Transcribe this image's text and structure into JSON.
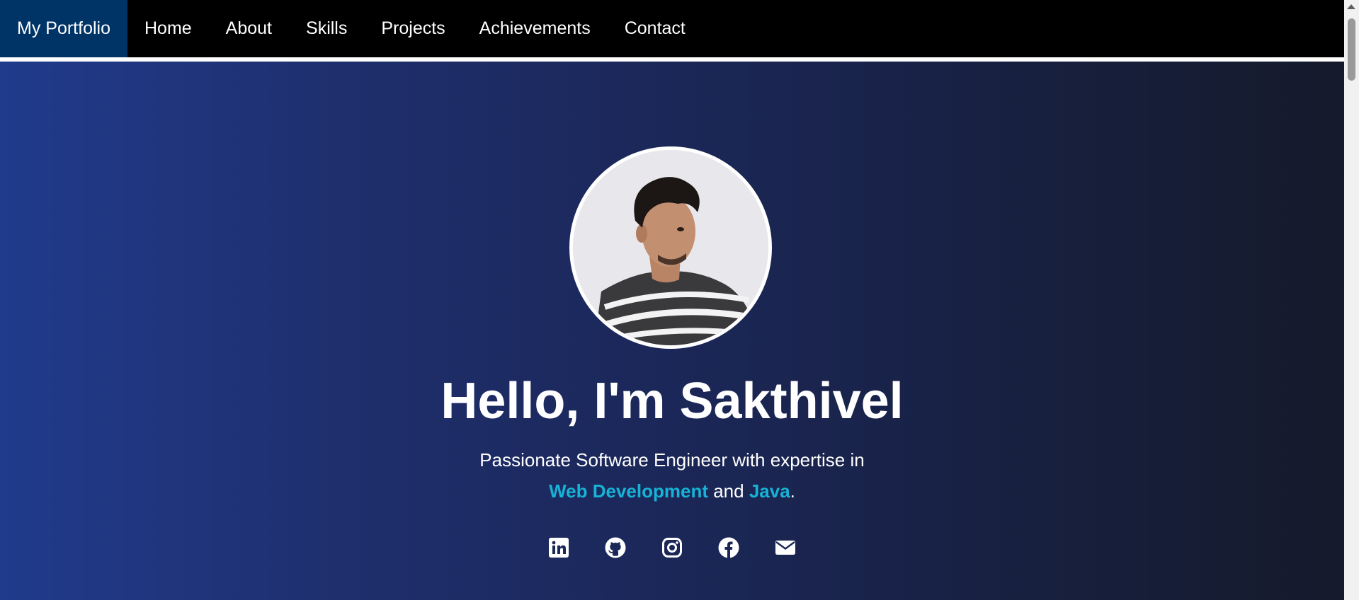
{
  "navbar": {
    "brand": "My Portfolio",
    "links": [
      "Home",
      "About",
      "Skills",
      "Projects",
      "Achievements",
      "Contact"
    ]
  },
  "hero": {
    "title": "Hello, I'm Sakthivel",
    "subtitle_line1": "Passionate Software Engineer with expertise in",
    "highlight1": "Web Development",
    "connector": " and ",
    "highlight2": "Java",
    "end": "."
  },
  "socials": [
    {
      "icon": "linkedin-icon"
    },
    {
      "icon": "github-icon"
    },
    {
      "icon": "instagram-icon"
    },
    {
      "icon": "facebook-icon"
    },
    {
      "icon": "email-icon"
    }
  ],
  "colors": {
    "brand_bg": "#003366",
    "accent": "#17b3d6",
    "navbar_bg": "#000000",
    "hero_gradient_start": "#203b8c",
    "hero_gradient_end": "#151a2b"
  }
}
